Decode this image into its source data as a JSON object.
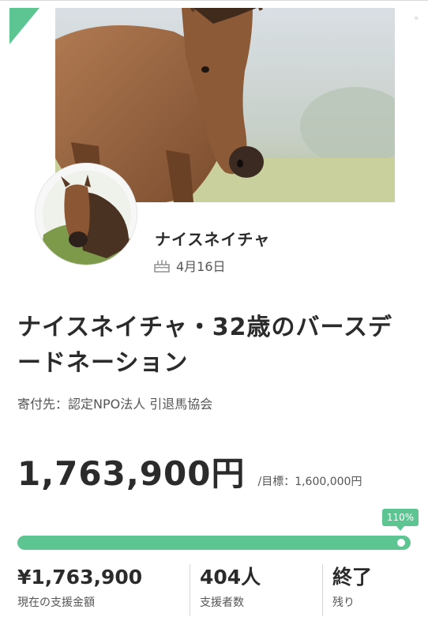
{
  "profile": {
    "name": "ナイスネイチャ",
    "birthday": "4月16日",
    "birthday_icon": "cake-icon"
  },
  "project": {
    "title": "ナイスネイチャ・32歳のバースデードネーション",
    "recipient": "寄付先：認定NPO法人 引退馬協会"
  },
  "funding": {
    "amount": "1,763,900円",
    "goal": "/目標：1,600,000円",
    "percent_label": "110%",
    "progress": 1.0
  },
  "stats": [
    {
      "value": "¥1,763,900",
      "label": "現在の支援金額"
    },
    {
      "value": "404人",
      "label": "支援者数"
    },
    {
      "value": "終了",
      "label": "残り"
    }
  ],
  "colors": {
    "accent": "#5cc592",
    "text": "#2b2b2b",
    "muted": "#555555"
  }
}
